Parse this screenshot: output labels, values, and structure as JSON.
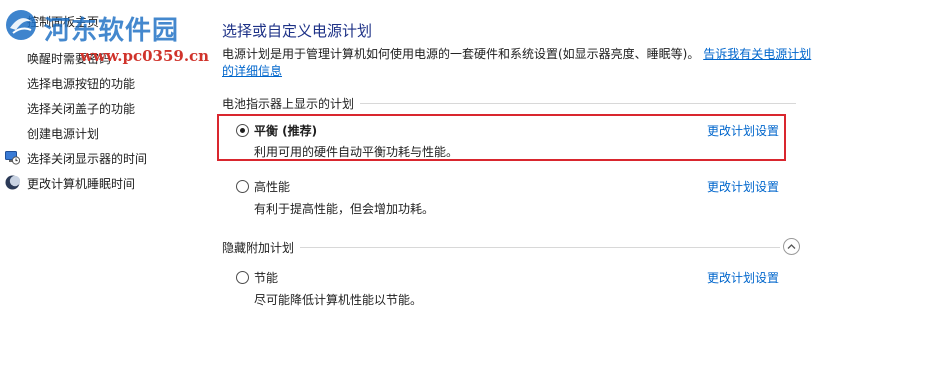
{
  "sidebar": {
    "items": [
      {
        "label": "控制面板主页"
      },
      {
        "label": "唤醒时需要密码"
      },
      {
        "label": "选择电源按钮的功能"
      },
      {
        "label": "选择关闭盖子的功能"
      },
      {
        "label": "创建电源计划"
      },
      {
        "label": "选择关闭显示器的时间",
        "icon": "monitor-clock-icon"
      },
      {
        "label": "更改计算机睡眠时间",
        "icon": "moon-icon"
      }
    ]
  },
  "watermark": {
    "name": "河东软件园",
    "url": "www.pc0359.cn",
    "icon": "hedong-logo-icon",
    "colors": {
      "name": "#1c6fc4",
      "url": "#d0332b"
    }
  },
  "main": {
    "title": "选择或自定义电源计划",
    "description": "电源计划是用于管理计算机如何使用电源的一套硬件和系统设置(如显示器亮度、睡眠等)。",
    "description_link": "告诉我有关电源计划的详细信息",
    "battery_group": {
      "header": "电池指示器上显示的计划",
      "plans": [
        {
          "name": "平衡 (推荐)",
          "description": "利用可用的硬件自动平衡功耗与性能。",
          "link": "更改计划设置",
          "selected": true
        },
        {
          "name": "高性能",
          "description": "有利于提高性能，但会增加功耗。",
          "link": "更改计划设置",
          "selected": false
        }
      ]
    },
    "hidden_group": {
      "header": "隐藏附加计划",
      "collapse_icon": "chevron-up-icon",
      "plans": [
        {
          "name": "节能",
          "description": "尽可能降低计算机性能以节能。",
          "link": "更改计划设置",
          "selected": false
        }
      ]
    }
  },
  "colors": {
    "title": "#1e3287",
    "link": "#0066cc",
    "highlight": "#d9262e"
  }
}
